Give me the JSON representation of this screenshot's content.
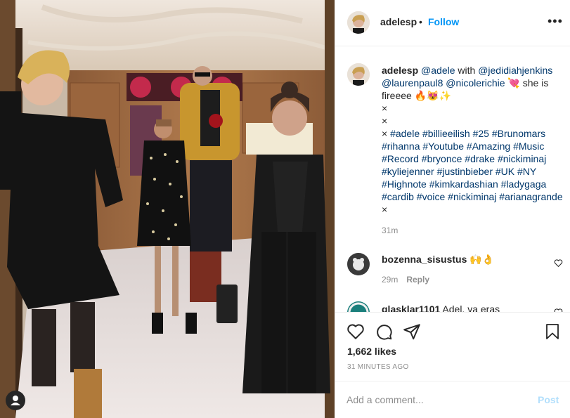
{
  "post": {
    "username": "adelesp",
    "dot": "•",
    "follow_label": "Follow",
    "more_label": "•••"
  },
  "caption": {
    "username": "adelesp",
    "line1": {
      "mention_a": "@adele",
      "with": " with ",
      "mention_b": "@jedidiahjenkins"
    },
    "line2": {
      "mention_c": "@laurenpaul8",
      "mention_d": "@nicolerichie",
      "emoji": "💘",
      "rest": " she is"
    },
    "line3": "fireeee 🔥😻✨",
    "line4": "×",
    "line5": "×",
    "line6_prefix": "× ",
    "tags": "#adele #billieeilish #25 #Brunomars #rihanna #Youtube #Amazing #Music #Record #bryonce #drake #nickiminaj #kyliejenner #justinbieber #UK #NY #Highnote #kimkardashian #ladygaga #cardib #voice #nickiminaj #arianagrande",
    "tags_suffix": " ×",
    "time": "31m"
  },
  "comments": [
    {
      "username": "bozenna_sisustus",
      "text": " 🙌👌",
      "time": "29m",
      "reply_label": "Reply"
    },
    {
      "username": "glasklar1101",
      "text": " Adel, va eras"
    }
  ],
  "likes": "1,662 likes",
  "time_ago": "31 MINUTES AGO",
  "add_comment": {
    "placeholder": "Add a comment...",
    "post_label": "Post"
  },
  "colors": {
    "accent": "#0095f6",
    "link": "#00376b",
    "muted": "#8e8e8e",
    "post_disabled": "#b2dffc"
  }
}
